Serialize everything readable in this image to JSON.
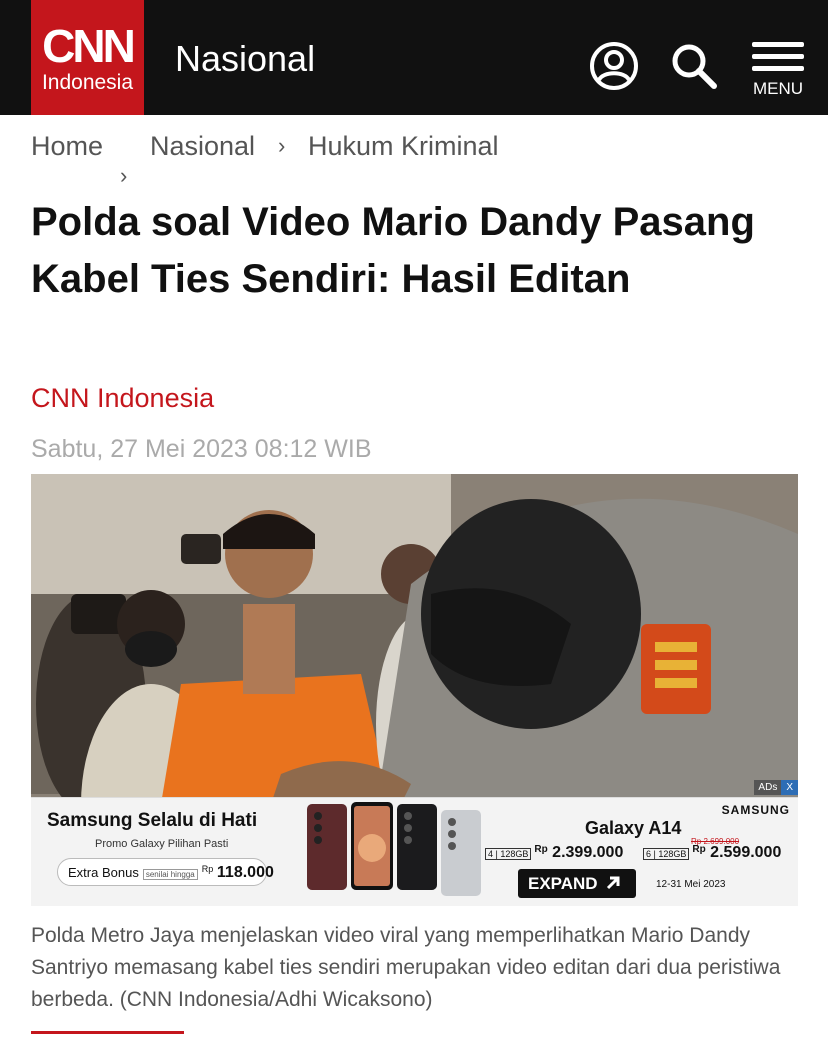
{
  "header": {
    "logo_main": "CNN",
    "logo_sub": "Indonesia",
    "section": "Nasional",
    "account_icon": "user-circle-icon",
    "search_icon": "search-icon",
    "menu_icon": "hamburger-menu-icon",
    "menu_label": "MENU"
  },
  "breadcrumb": [
    {
      "label": "Home"
    },
    {
      "label": "Nasional"
    },
    {
      "label": "Hukum Kriminal"
    }
  ],
  "article": {
    "headline": "Polda soal Video Mario Dandy Pasang Kabel Ties Sendiri: Hasil Editan",
    "author": "CNN Indonesia",
    "date": "Sabtu, 27 Mei 2023 08:12 WIB",
    "caption": "Polda Metro Jaya menjelaskan video viral yang memperlihatkan Mario Dandy Santriyo memasang kabel ties sendiri merupakan video editan dari dua peristiwa berbeda. (CNN Indonesia/Adhi Wicaksono)"
  },
  "ad": {
    "badge": "ADs",
    "close": "X",
    "headline": "Samsung Selalu di Hati",
    "promo": "Promo Galaxy Pilihan Pasti",
    "bonus_label": "Extra Bonus",
    "bonus_note": "senilai hingga",
    "bonus_currency": "Rp",
    "bonus_amount": "118.000",
    "brand": "SAMSUNG",
    "model": "Galaxy A14",
    "variant1": "4 | 128GB",
    "currency": "Rp",
    "price1": "2.399.000",
    "variant2": "6 | 128GB",
    "old_price": "Rp 2.699.000",
    "price2": "2.599.000",
    "cta": "EXPAND",
    "period": "12-31 Mei 2023",
    "colors": {
      "accent": "#c4161c",
      "cta": "#111111"
    }
  },
  "colors": {
    "brand_red": "#c4161c",
    "topbar": "#111111"
  }
}
